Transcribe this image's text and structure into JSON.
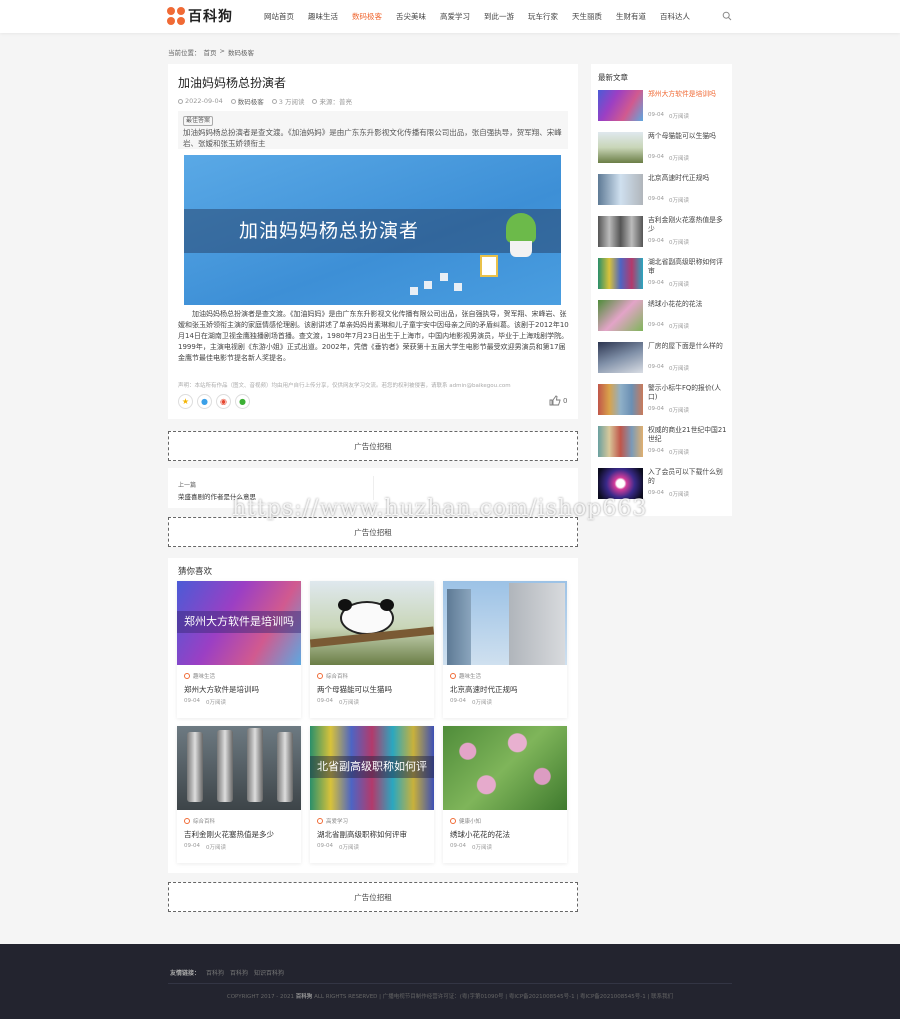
{
  "header": {
    "logo_text": "百科狗",
    "nav": [
      "网站首页",
      "趣味生活",
      "数码极客",
      "舌尖美味",
      "高爱学习",
      "到此一游",
      "玩车行家",
      "天生丽质",
      "生财有道",
      "百科达人"
    ],
    "active_index": 2,
    "accent_color": "#f06a35"
  },
  "breadcrumb": {
    "prefix": "当前位置：",
    "home": "首页",
    "sep": ">",
    "current": "数码极客"
  },
  "article": {
    "title": "加油妈妈杨总扮演者",
    "date": "2022-09-04",
    "category": "数码极客",
    "views": "3 万阅读",
    "source": "来源：普亮",
    "summary_tag": "最佳答案",
    "summary": "加油妈妈杨总扮演者是查文渡。《加油妈妈》是由广东东升影视文化传播有限公司出品，张自强执导，贺军翔、宋峰岩、张嫒和张玉娇领衔主",
    "hero_text": "加油妈妈杨总扮演者",
    "body": "加油妈妈杨总扮演者是查文渡。《加油妈妈》是由广东东升影视文化传播有限公司出品，张自强执导，贺军翔、宋峰岩、张嫒和张玉娇领衔主演的家庭情感伦理剧。该剧讲述了单亲妈妈肖素琳和儿子童宇安中因母亲之间的矛盾纠葛。该剧于2012年10月14日在湖南卫视金鹰独播剧场首播。查文渡，1980年7月23日出生于上海市，中国内地影视男演员，毕业于上海戏剧学院。1999年，主演电视剧《东游小姐》正式出道。2002年，凭借《垂钓者》荣获第十五届大学生电影节最受欢迎男演员和第17届金鹰节最佳电影节提名新人奖提名。",
    "author": "声明：本站所有作品（图文、音视频）均由用户自行上传分享，仅供网友学习交流。若您的权利被侵害，请联系 admin@baikegou.com",
    "likes": "0"
  },
  "ads": [
    "广告位招租",
    "广告位招租",
    "广告位招租"
  ],
  "prevnext": {
    "label": "上一篇",
    "title": "荣盛喜剧的作者是什么意思"
  },
  "recommend": {
    "title": "猜你喜欢",
    "items": [
      {
        "overlay": "郑州大方软件是培训吗",
        "category": "趣味生活",
        "name": "郑州大方软件是培训吗",
        "date": "09-04",
        "views": "0万阅读"
      },
      {
        "overlay": "",
        "category": "综合百科",
        "name": "两个母猫能可以生猫吗",
        "date": "09-04",
        "views": "0万阅读"
      },
      {
        "overlay": "",
        "category": "趣味生活",
        "name": "北京高速时代正规吗",
        "date": "09-04",
        "views": "0万阅读"
      },
      {
        "overlay": "",
        "category": "综合百科",
        "name": "吉利金刚火花塞热值是多少",
        "date": "09-04",
        "views": "0万阅读"
      },
      {
        "overlay": "北省副高级职称如何评",
        "category": "高爱学习",
        "name": "湖北省副高级职称如何评审",
        "date": "09-04",
        "views": "0万阅读"
      },
      {
        "overlay": "",
        "category": "健康小知",
        "name": "绣球小花花的花法",
        "date": "09-04",
        "views": "0万阅读"
      }
    ]
  },
  "sidebar": {
    "title": "最新文章",
    "items": [
      {
        "name": "郑州大方软件是培训吗",
        "date": "09-04",
        "views": "0万阅读"
      },
      {
        "name": "两个母猫能可以生猫吗",
        "date": "09-04",
        "views": "0万阅读"
      },
      {
        "name": "北京高速时代正规吗",
        "date": "09-04",
        "views": "0万阅读"
      },
      {
        "name": "吉利金刚火花塞热值是多少",
        "date": "09-04",
        "views": "0万阅读"
      },
      {
        "name": "湖北省副高级职称如何评审",
        "date": "09-04",
        "views": "0万阅读"
      },
      {
        "name": "绣球小花花的花法",
        "date": "09-04",
        "views": "0万阅读"
      },
      {
        "name": "厂房的屋下面是什么样的",
        "date": "09-04",
        "views": "0万阅读"
      },
      {
        "name": "警示小标牛FQ的报价(人口)",
        "date": "09-04",
        "views": "0万阅读"
      },
      {
        "name": "权威的商业21世纪中国21世纪",
        "date": "09-04",
        "views": "0万阅读"
      },
      {
        "name": "入了会员可以下载什么别的",
        "date": "09-04",
        "views": "0万阅读"
      }
    ]
  },
  "footer": {
    "links_label": "友情链接：",
    "links": [
      "百科狗",
      "百科狗",
      "知识百科狗"
    ],
    "copyright_prefix": "COPYRIGHT 2017 - 2021",
    "brand": "百科狗",
    "copyright_rest": " ALL RIGHTS RESERVED | 广播电视节目制作经营许可证：(粤)字第01090号 | 粤ICP备2021008545号-1 | 粤ICP备2021008545号-1 | 联系我们"
  },
  "watermark": "https://www.huzhan.com/ishop663"
}
